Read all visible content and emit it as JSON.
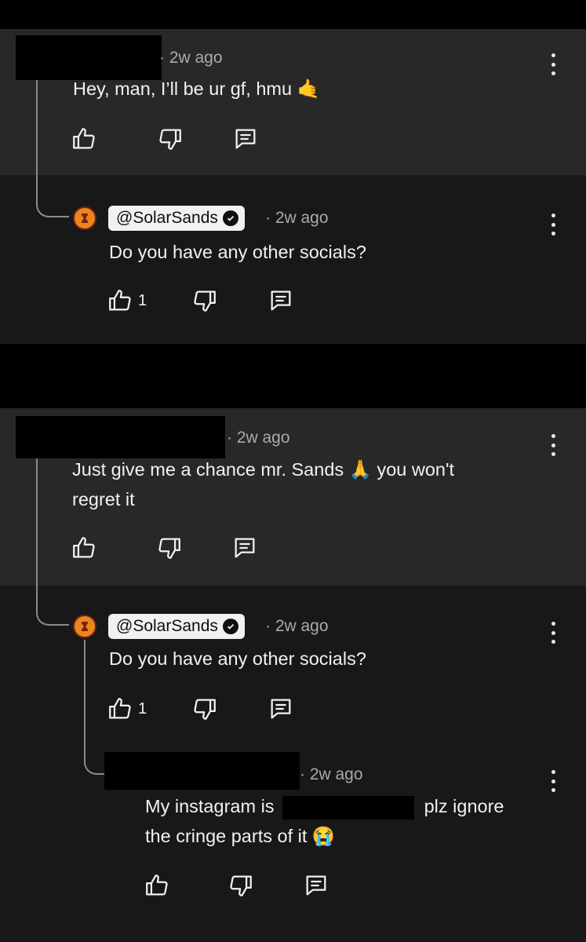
{
  "colors": {
    "parent_bg": "#282828",
    "reply_bg": "#181818",
    "page_bg": "#000000",
    "avatar_orange": "#e8871e",
    "chip_bg": "#f1f1f1"
  },
  "threads": [
    {
      "comment": {
        "time": "· 2w ago",
        "text": "Hey, man, I’ll be ur gf, hmu 🤙"
      },
      "reply": {
        "author": "@SolarSands",
        "time": "· 2w ago",
        "text": "Do you have any other socials?",
        "likes": "1"
      }
    },
    {
      "comment": {
        "time": "· 2w ago",
        "text_line1": "Just give me a chance mr. Sands 🙏 you won't",
        "text_line2": "regret it"
      },
      "reply": {
        "author": "@SolarSands",
        "time": "· 2w ago",
        "text": "Do you have any other socials?",
        "likes": "1"
      },
      "nested_reply": {
        "time": "· 2w ago",
        "text_line1_pre": "My instagram is",
        "text_line1_post": "plz ignore",
        "text_line2": "the cringe parts of it 😭"
      }
    }
  ]
}
